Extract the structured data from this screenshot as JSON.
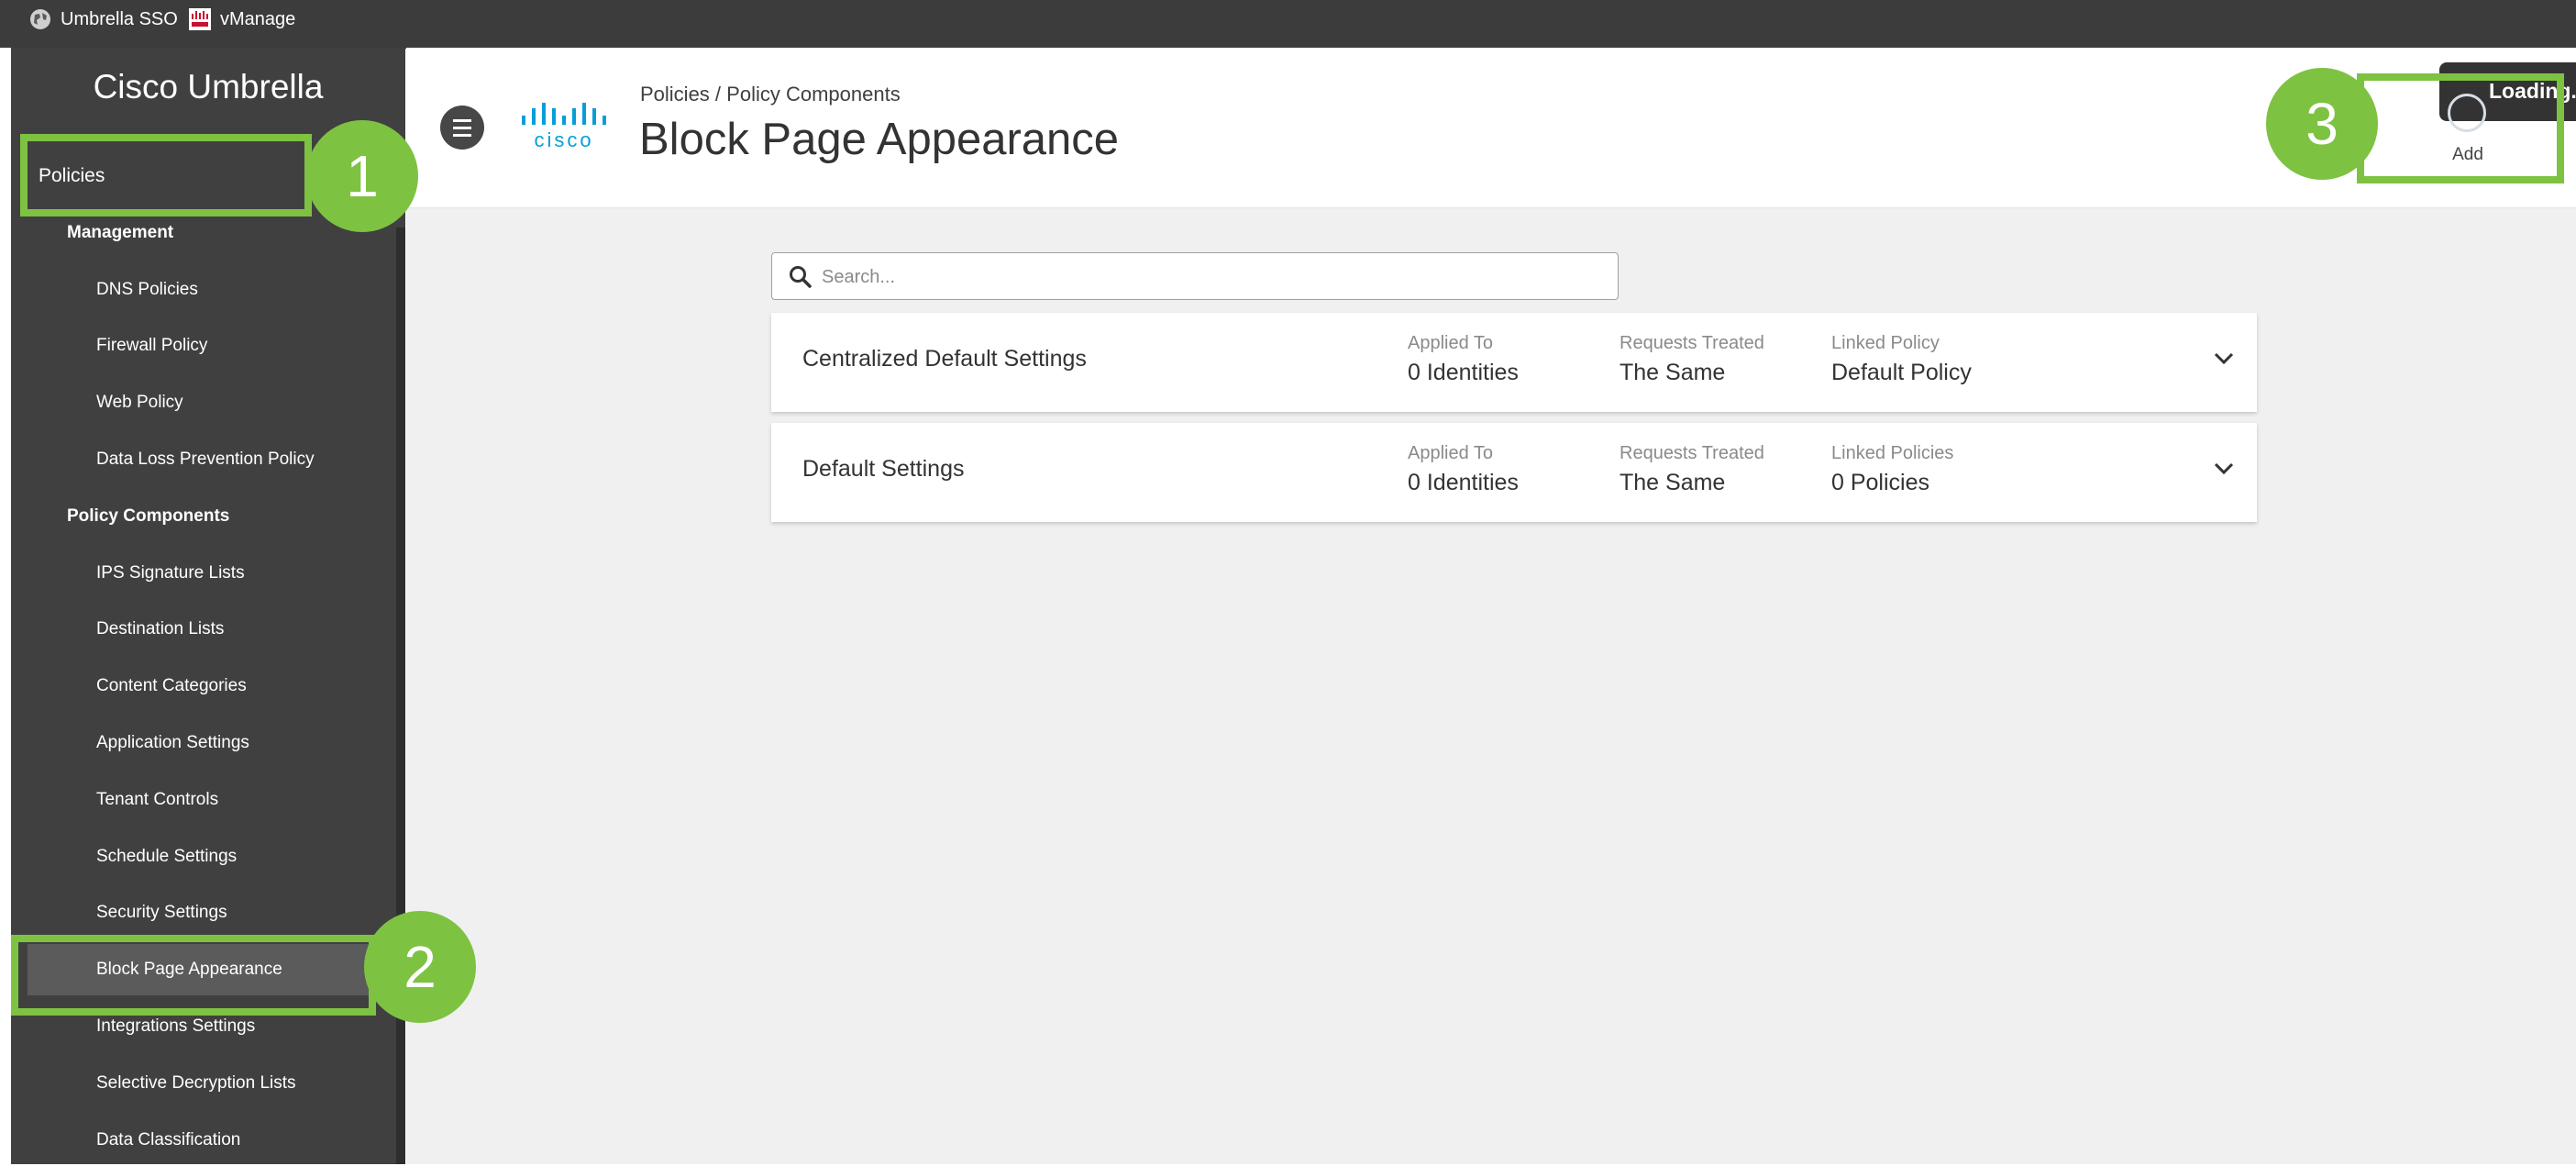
{
  "bookmarks": [
    {
      "label": "Umbrella SSO",
      "icon": "globe-icon"
    },
    {
      "label": "vManage",
      "icon": "cisco-favicon-icon"
    }
  ],
  "sidebar": {
    "brand": "Cisco Umbrella",
    "top_item": "Policies",
    "sections": [
      {
        "label": "Management",
        "items": [
          "DNS Policies",
          "Firewall Policy",
          "Web Policy",
          "Data Loss Prevention Policy"
        ]
      },
      {
        "label": "Policy Components",
        "items": [
          "IPS Signature Lists",
          "Destination Lists",
          "Content Categories",
          "Application Settings",
          "Tenant Controls",
          "Schedule Settings",
          "Security Settings",
          "Block Page Appearance",
          "Integrations Settings",
          "Selective Decryption Lists",
          "Data Classification"
        ]
      }
    ],
    "active_item": "Block Page Appearance"
  },
  "header": {
    "breadcrumb_parent": "Policies",
    "breadcrumb_separator": " / ",
    "breadcrumb_current": "Policy Components",
    "title": "Block Page Appearance",
    "loading_text": "Loading..",
    "add_label": "Add",
    "logo_text": "cisco"
  },
  "search": {
    "placeholder": "Search..."
  },
  "rows": [
    {
      "name": "Centralized Default Settings",
      "applied_label": "Applied To",
      "applied_value": "0 Identities",
      "requests_label": "Requests Treated",
      "requests_value": "The Same",
      "linked_label": "Linked Policy",
      "linked_value": "Default Policy"
    },
    {
      "name": "Default Settings",
      "applied_label": "Applied To",
      "applied_value": "0 Identities",
      "requests_label": "Requests Treated",
      "requests_value": "The Same",
      "linked_label": "Linked Policies",
      "linked_value": "0 Policies"
    }
  ],
  "annotations": [
    "1",
    "2",
    "3"
  ],
  "colors": {
    "annotation": "#7ec242",
    "sidebar": "#404040",
    "sidebar_active": "#5b5b5b",
    "main_bg": "#f0f0f0",
    "cisco_blue": "#049fd9"
  }
}
